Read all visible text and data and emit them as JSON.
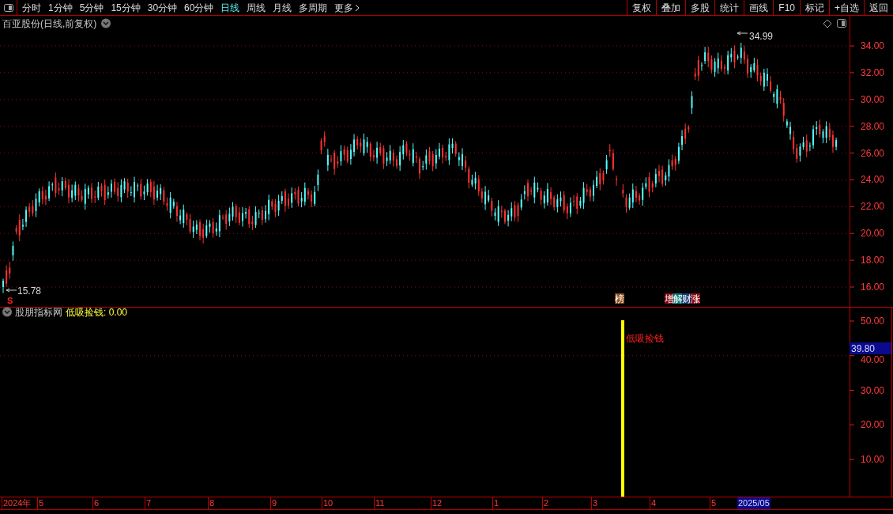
{
  "toolbar": {
    "periods": [
      {
        "label": "分时",
        "selected": false
      },
      {
        "label": "1分钟",
        "selected": false
      },
      {
        "label": "5分钟",
        "selected": false
      },
      {
        "label": "15分钟",
        "selected": false
      },
      {
        "label": "30分钟",
        "selected": false
      },
      {
        "label": "60分钟",
        "selected": false
      },
      {
        "label": "日线",
        "selected": true
      },
      {
        "label": "周线",
        "selected": false
      },
      {
        "label": "月线",
        "selected": false
      },
      {
        "label": "多周期",
        "selected": false
      }
    ],
    "more": "更多",
    "actions": [
      "复权",
      "叠加",
      "多股",
      "统计",
      "画线",
      "F10",
      "标记",
      "+自选",
      "返回"
    ]
  },
  "main_chart": {
    "title": "百亚股份(日线,前复权)",
    "high_label": "34.99",
    "low_label": "15.78",
    "signal": "S",
    "badges": [
      {
        "text": "榜",
        "color": "#8b4a14"
      },
      {
        "text": "增",
        "color": "#8b0a14"
      },
      {
        "text": "解",
        "color": "#0a7a7a"
      },
      {
        "text": "财",
        "color": "#143c78"
      },
      {
        "text": "涨",
        "color": "#8b0a14"
      }
    ],
    "y_ticks": [
      "34.00",
      "32.00",
      "30.00",
      "28.00",
      "26.00",
      "24.00",
      "22.00",
      "20.00",
      "18.00",
      "16.00"
    ]
  },
  "indicator": {
    "source": "股朋指标网",
    "readout": "低吸捡钱: 0.00",
    "signal_label": "低吸捡钱",
    "current_value": "39.80",
    "y_ticks": [
      "50.00",
      "40.00",
      "30.00",
      "20.00",
      "10.00"
    ]
  },
  "date_axis": {
    "labels": [
      "2024年",
      "5",
      "6",
      "7",
      "8",
      "9",
      "10",
      "11",
      "12",
      "1",
      "2",
      "3",
      "4",
      "5"
    ],
    "current": "2025/05"
  }
}
